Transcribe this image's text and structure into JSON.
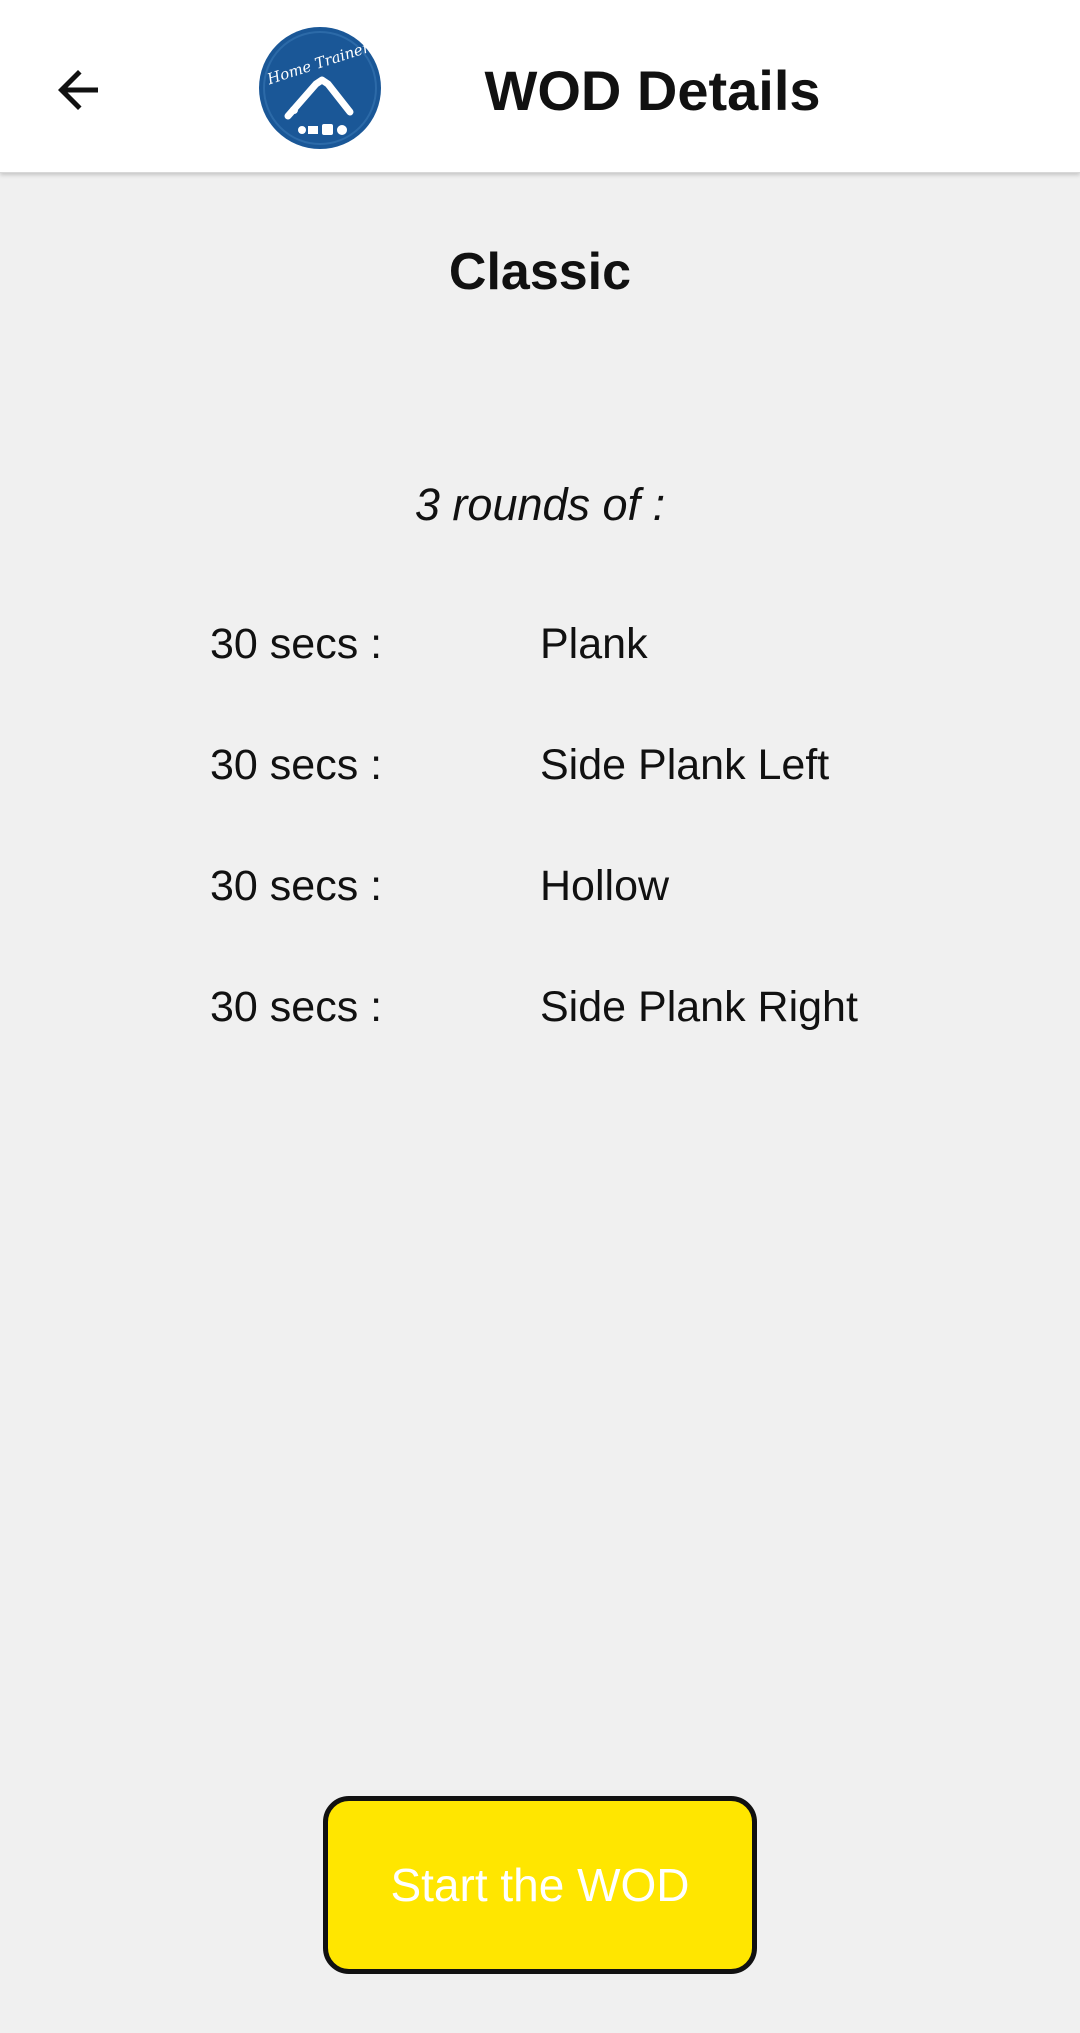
{
  "header": {
    "back_icon": "arrow-left-icon",
    "logo_text": "Home Trainer",
    "logo_color": "#1a5797",
    "title": "WOD Details"
  },
  "wod": {
    "name": "Classic",
    "rounds_label": "3 rounds of :",
    "exercises": [
      {
        "duration": "30 secs :",
        "name": "Plank"
      },
      {
        "duration": "30 secs :",
        "name": "Side Plank Left"
      },
      {
        "duration": "30 secs :",
        "name": "Hollow"
      },
      {
        "duration": "30 secs :",
        "name": "Side Plank Right"
      }
    ]
  },
  "actions": {
    "start_label": "Start the WOD",
    "start_color": "#ffe600"
  }
}
